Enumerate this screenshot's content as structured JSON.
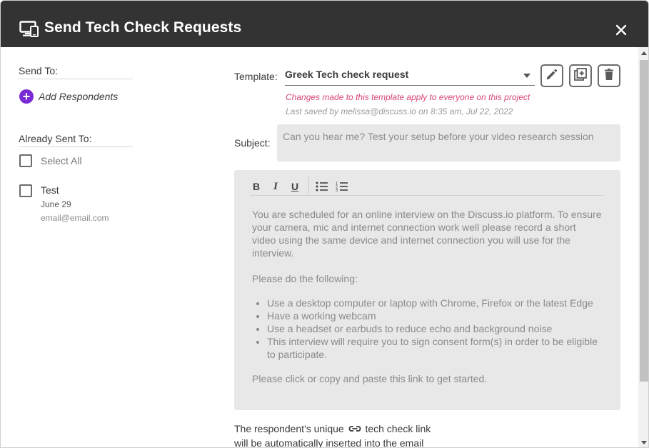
{
  "header": {
    "title": "Send Tech Check Requests",
    "icon": "monitor-check-icon",
    "close_icon": "close-icon"
  },
  "left": {
    "send_to_label": "Send To:",
    "add_respondents_label": "Add Respondents",
    "already_sent_label": "Already Sent To:",
    "select_all_label": "Select All",
    "recipients": [
      {
        "name": "Test",
        "date": "June 29",
        "email": "email@email.com",
        "checked": false
      }
    ]
  },
  "template": {
    "label": "Template:",
    "selected": "Greek Tech check request",
    "warning": "Changes made to this template apply to everyone on this project",
    "last_saved": "Last saved by melissa@discuss.io on 8:35 am, Jul 22, 2022",
    "buttons": [
      "edit-icon",
      "duplicate-icon",
      "trash-icon"
    ]
  },
  "subject": {
    "label": "Subject:",
    "placeholder": "Can you hear me? Test your setup before your video research session"
  },
  "editor": {
    "toolbar": [
      "B",
      "I",
      "U",
      "bulleted-list-icon",
      "numbered-list-icon"
    ],
    "para1": "You are scheduled for an online interview on the Discuss.io platform. To ensure your camera, mic and internet connection work well please record a short video using the same device and internet connection you will use for the interview.",
    "para2": "Please do the following:",
    "bullets": [
      "Use a desktop computer or laptop with Chrome, Firefox or the latest Edge",
      "Have a working webcam",
      "Use a headset or earbuds to reduce echo and background noise",
      "This interview will require you to sign consent form(s) in order to be eligible to participate."
    ],
    "para3": "Please click or copy and paste this link to get started."
  },
  "footer": {
    "text_before": "The respondent's unique",
    "text_after": "tech check link",
    "text_line2": "will be automatically inserted into the email"
  },
  "colors": {
    "header_bg": "#333333",
    "accent": "#7a2ad4",
    "warning": "#d9467a",
    "field_bg": "#e8e8e8"
  }
}
